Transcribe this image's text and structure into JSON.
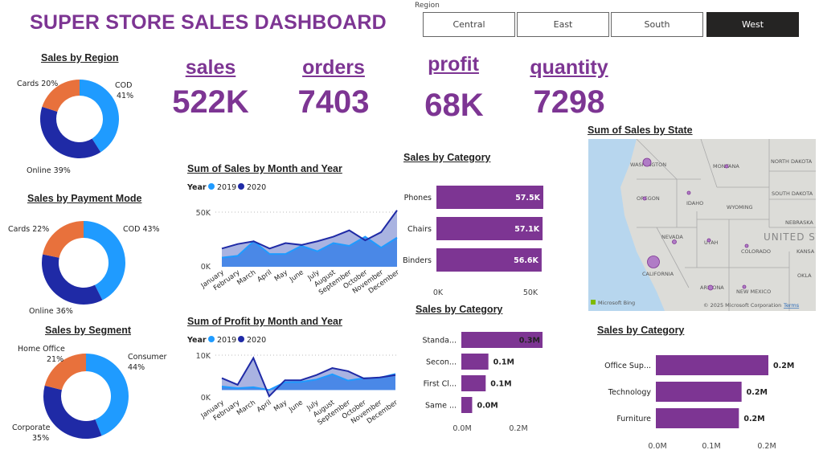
{
  "header": {
    "title": "SUPER STORE SALES DASHBOARD"
  },
  "slicer": {
    "label": "Region",
    "options": [
      "Central",
      "East",
      "South",
      "West"
    ],
    "selected": "West"
  },
  "kpis": [
    {
      "label": "sales",
      "value": "522K"
    },
    {
      "label": "orders",
      "value": "7403"
    },
    {
      "label": "profit",
      "value": "68K"
    },
    {
      "label": "quantity",
      "value": "7298"
    }
  ],
  "colors": {
    "purple": "#7d3593",
    "orange": "#e8713c",
    "blue": "#1f9bff",
    "navy": "#1f2aa6",
    "lightblue": "#3f83e8"
  },
  "donuts": {
    "region": {
      "title": "Sales by Region",
      "slices": [
        {
          "name": "COD",
          "pct": 41,
          "color": "#1f9bff",
          "label": "COD",
          "pct_label": "41%"
        },
        {
          "name": "Online",
          "pct": 39,
          "color": "#1f2aa6",
          "label": "Online 39%"
        },
        {
          "name": "Cards",
          "pct": 20,
          "color": "#e8713c",
          "label": "Cards 20%"
        }
      ]
    },
    "payment": {
      "title": "Sales by Payment Mode",
      "slices": [
        {
          "name": "COD",
          "pct": 43,
          "color": "#1f9bff",
          "label": "COD 43%"
        },
        {
          "name": "Online",
          "pct": 36,
          "color": "#1f2aa6",
          "label": "Online 36%"
        },
        {
          "name": "Cards",
          "pct": 22,
          "color": "#e8713c",
          "label": "Cards 22%"
        }
      ]
    },
    "segment": {
      "title": "Sales by Segment",
      "slices": [
        {
          "name": "Consumer",
          "pct": 44,
          "color": "#1f9bff",
          "label": "Consumer",
          "pct_label": "44%"
        },
        {
          "name": "Corporate",
          "pct": 35,
          "color": "#1f2aa6",
          "label": "Corporate",
          "pct_label": "35%"
        },
        {
          "name": "Home Office",
          "pct": 21,
          "color": "#e8713c",
          "label": "Home Office",
          "pct_label": "21%"
        }
      ]
    }
  },
  "chart_data": [
    {
      "type": "area",
      "title": "Sum of Sales by Month and Year",
      "legend_title": "Year",
      "categories": [
        "January",
        "February",
        "March",
        "April",
        "May",
        "June",
        "July",
        "August",
        "September",
        "October",
        "November",
        "December"
      ],
      "series": [
        {
          "name": "2019",
          "values": [
            10,
            12,
            28,
            14,
            14,
            23,
            17,
            26,
            23,
            33,
            21,
            32
          ]
        },
        {
          "name": "2020",
          "values": [
            20,
            25,
            28,
            20,
            26,
            24,
            28,
            33,
            40,
            29,
            38,
            62
          ]
        }
      ],
      "yticks": [
        "50K",
        "0K"
      ],
      "ylim": [
        0,
        60
      ]
    },
    {
      "type": "area",
      "title": "Sum of Profit by Month and Year",
      "legend_title": "Year",
      "categories": [
        "January",
        "February",
        "March",
        "April",
        "May",
        "June",
        "July",
        "August",
        "September",
        "October",
        "November",
        "December"
      ],
      "series": [
        {
          "name": "2019",
          "values": [
            1.0,
            0.5,
            0.8,
            0.0,
            2.2,
            2.3,
            3.0,
            4.5,
            2.7,
            3.4,
            3.5,
            4.6
          ]
        },
        {
          "name": "2020",
          "values": [
            3.4,
            1.5,
            9.2,
            -1.8,
            2.8,
            2.8,
            4.3,
            6.3,
            5.4,
            3.3,
            3.6,
            4.3
          ]
        }
      ],
      "yticks": [
        "10K",
        "0K"
      ],
      "ylim": [
        -2,
        10
      ]
    },
    {
      "type": "bar",
      "title": "Sales by Category",
      "categories": [
        "Phones",
        "Chairs",
        "Binders"
      ],
      "values": [
        57.5,
        57.1,
        56.6
      ],
      "labels": [
        "57.5K",
        "57.1K",
        "56.6K"
      ],
      "xticks": [
        "0K",
        "50K"
      ],
      "xlim": [
        0,
        57.5
      ]
    },
    {
      "type": "bar",
      "title": "Sales by Category",
      "categories": [
        "Standa...",
        "Secon...",
        "First Cl...",
        "Same ..."
      ],
      "values": [
        0.3,
        0.1,
        0.09,
        0.04
      ],
      "labels": [
        "0.3M",
        "0.1M",
        "0.1M",
        "0.0M"
      ],
      "xticks": [
        "0.0M",
        "0.2M"
      ],
      "xlim": [
        0,
        0.3
      ]
    },
    {
      "type": "bar",
      "title": "Sales by Category",
      "categories": [
        "Office Sup...",
        "Technology",
        "Furniture"
      ],
      "values": [
        0.21,
        0.16,
        0.155
      ],
      "labels": [
        "0.2M",
        "0.2M",
        "0.2M"
      ],
      "xticks": [
        "0.0M",
        "0.1M",
        "0.2M"
      ],
      "xlim": [
        0,
        0.21
      ]
    }
  ],
  "map": {
    "title": "Sum of Sales by State",
    "states": [
      "WASHINGTON",
      "MONTANA",
      "NORTH DAKOTA",
      "OREGON",
      "IDAHO",
      "WYOMING",
      "SOUTH DAKOTA",
      "NEBRASKA",
      "NEVADA",
      "UTAH",
      "COLORADO",
      "KANSA",
      "CALIFORNIA",
      "ARIZONA",
      "NEW MEXICO",
      "OKLA"
    ],
    "country_label": "UNITED ST",
    "attribution": "© 2025 Microsoft Corporation",
    "terms": "Terms",
    "brand": "Microsoft Bing"
  }
}
